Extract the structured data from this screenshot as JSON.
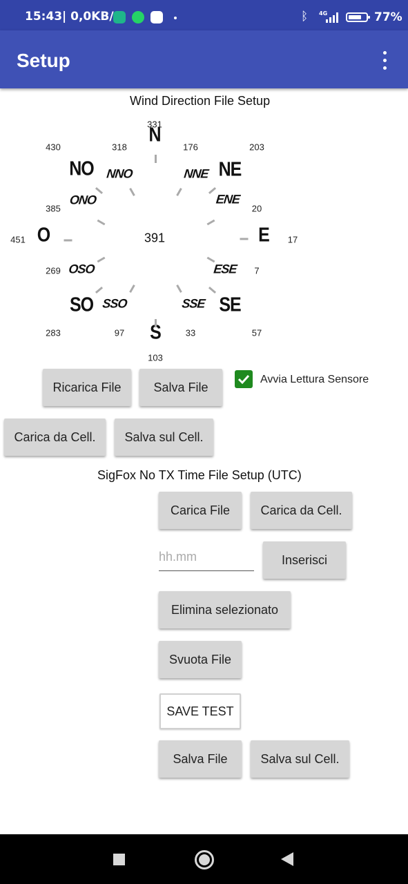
{
  "status_bar": {
    "time": "15:43",
    "network_speed": "| 0,0KB/s",
    "battery_percent": "77%",
    "battery_level": 0.77,
    "signal_type": "4G",
    "icons": [
      "shield-icon",
      "whatsapp-icon",
      "gmail-icon",
      "bluetooth-icon",
      "signal-icon",
      "battery-icon"
    ]
  },
  "app_bar": {
    "title": "Setup",
    "menu_icon": "more-vert-icon"
  },
  "wind_section": {
    "title": "Wind Direction File Setup",
    "center_value": "391",
    "directions": [
      {
        "label": "N",
        "value": "331"
      },
      {
        "label": "NNE",
        "value": "176"
      },
      {
        "label": "NE",
        "value": "203"
      },
      {
        "label": "ENE",
        "value": "20"
      },
      {
        "label": "E",
        "value": "17"
      },
      {
        "label": "ESE",
        "value": "7"
      },
      {
        "label": "SE",
        "value": "57"
      },
      {
        "label": "SSE",
        "value": "33"
      },
      {
        "label": "S",
        "value": "103"
      },
      {
        "label": "SSO",
        "value": "97"
      },
      {
        "label": "SO",
        "value": "283"
      },
      {
        "label": "OSO",
        "value": "269"
      },
      {
        "label": "O",
        "value": "451"
      },
      {
        "label": "ONO",
        "value": "385"
      },
      {
        "label": "NO",
        "value": "430"
      },
      {
        "label": "NNO",
        "value": "318"
      }
    ],
    "buttons": {
      "reload": "Ricarica File",
      "save": "Salva File",
      "load_phone": "Carica da Cell.",
      "save_phone": "Salva sul Cell."
    },
    "sensor_checkbox": {
      "label": "Avvia Lettura Sensore",
      "checked": true
    }
  },
  "sigfox_section": {
    "title": "SigFox No TX Time File Setup (UTC)",
    "buttons": {
      "load_file": "Carica File",
      "load_phone": "Carica da Cell.",
      "insert": "Inserisci",
      "delete_selected": "Elimina selezionato",
      "empty_file": "Svuota File",
      "save_test": "SAVE TEST",
      "save_file": "Salva File",
      "save_phone": "Salva sul Cell."
    },
    "time_input": {
      "placeholder": "hh.mm",
      "value": ""
    }
  },
  "colors": {
    "status_bar": "#3344a8",
    "app_bar": "#3f51b5",
    "button": "#d6d6d6",
    "checkbox": "#1f8a1f"
  }
}
